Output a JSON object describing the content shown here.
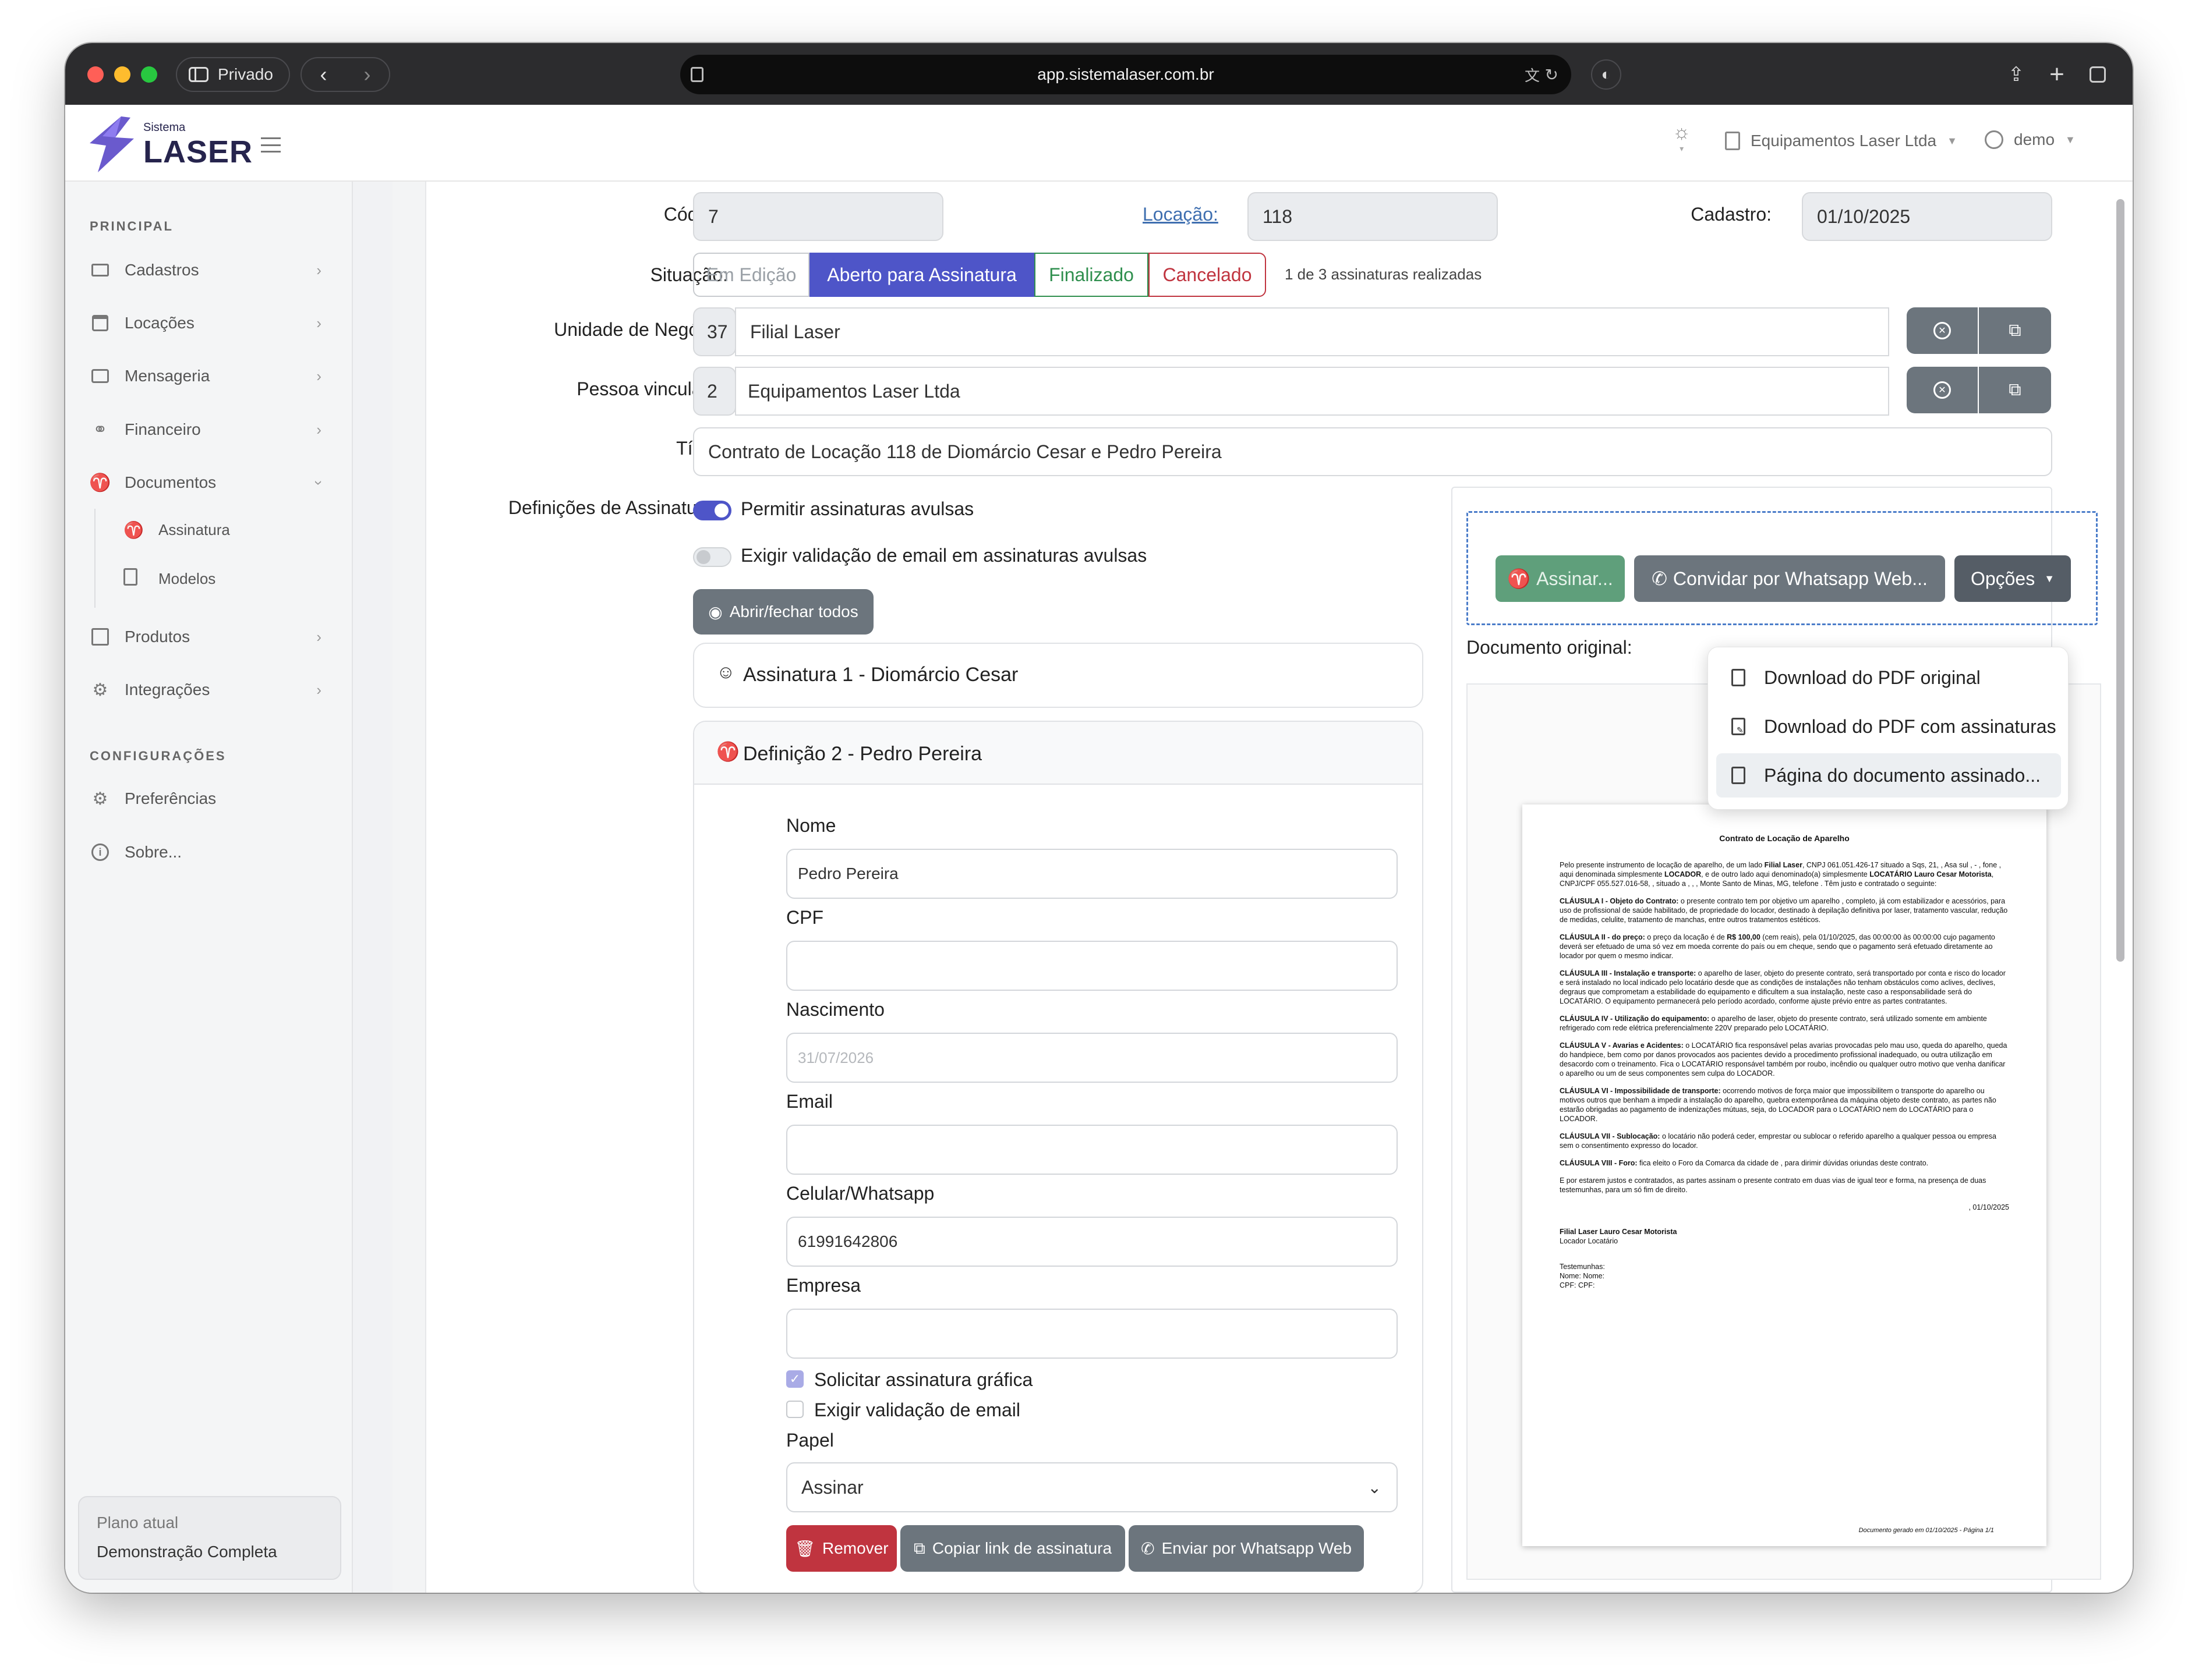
{
  "browser": {
    "private_label": "Privado",
    "url": "app.sistemalaser.com.br"
  },
  "header": {
    "logo_small": "Sistema",
    "logo_main": "LASER",
    "company": "Equipamentos Laser Ltda",
    "user": "demo"
  },
  "sidebar": {
    "section_principal": "PRINCIPAL",
    "items": [
      {
        "label": "Cadastros"
      },
      {
        "label": "Locações"
      },
      {
        "label": "Mensageria"
      },
      {
        "label": "Financeiro"
      },
      {
        "label": "Documentos"
      }
    ],
    "sub_items": [
      {
        "label": "Assinatura"
      },
      {
        "label": "Modelos"
      }
    ],
    "items2": [
      {
        "label": "Produtos"
      },
      {
        "label": "Integrações"
      }
    ],
    "section_config": "CONFIGURAÇÕES",
    "config_items": [
      {
        "label": "Preferências"
      },
      {
        "label": "Sobre..."
      }
    ],
    "plan_label": "Plano atual",
    "plan_value": "Demonstração Completa"
  },
  "form": {
    "codigo_label": "Código:",
    "codigo_value": "7",
    "locacao_label": "Locação:",
    "locacao_value": "118",
    "cadastro_label": "Cadastro:",
    "cadastro_value": "01/10/2025",
    "situacao_label": "Situação:",
    "situacao_options": [
      "Em Edição",
      "Aberto para Assinatura",
      "Finalizado",
      "Cancelado"
    ],
    "assinaturas_count": "1 de 3 assinaturas realizadas",
    "unidade_label": "Unidade de Negócio:",
    "unidade_id": "37",
    "unidade_name": "Filial Laser",
    "pessoa_label": "Pessoa vinculada:",
    "pessoa_id": "2",
    "pessoa_name": "Equipamentos Laser Ltda",
    "titulo_label": "Título:",
    "titulo_value": "Contrato de Locação 118 de Diomárcio Cesar e Pedro Pereira",
    "definicoes_label": "Definições de Assinaturas:",
    "toggle_avulsas": "Permitir assinaturas avulsas",
    "toggle_email": "Exigir validação de email em assinaturas avulsas",
    "abrir_fechar": "Abrir/fechar todos"
  },
  "signatures": {
    "sig1_title": "Assinatura 1 - Diomárcio Cesar",
    "def2_title": "Definição 2 - Pedro Pereira",
    "nome_label": "Nome",
    "nome_value": "Pedro Pereira",
    "cpf_label": "CPF",
    "cpf_value": "",
    "nasc_label": "Nascimento",
    "nasc_placeholder": "31/07/2026",
    "email_label": "Email",
    "email_value": "",
    "cel_label": "Celular/Whatsapp",
    "cel_value": "61991642806",
    "empresa_label": "Empresa",
    "empresa_value": "",
    "cb_grafica": "Solicitar assinatura gráfica",
    "cb_email": "Exigir validação de email",
    "papel_label": "Papel",
    "papel_value": "Assinar",
    "btn_remover": "Remover",
    "btn_copiar": "Copiar link de assinatura",
    "btn_whatsapp": "Enviar por Whatsapp Web"
  },
  "actions": {
    "assinar": "Assinar...",
    "convidar": "Convidar por Whatsapp Web...",
    "opcoes": "Opções",
    "doc_original_label": "Documento original:",
    "menu": [
      "Download do PDF original",
      "Download do PDF com assinaturas",
      "Página do documento assinado..."
    ]
  },
  "document": {
    "title": "Contrato de Locação de Aparelho",
    "intro_a": "Pelo presente instrumento de locação de aparelho, de um lado ",
    "intro_b": "Filial Laser",
    "intro_c": ", CNPJ 061.051.426-17 situado a Sqs, 21, , Asa sul , - , fone , aqui denominada simplesmente ",
    "intro_d": "LOCADOR",
    "intro_e": ", e de outro lado aqui denominado(a) simplesmente ",
    "intro_f": "LOCATÁRIO Lauro Cesar Motorista",
    "intro_g": ", CNPJ/CPF 055.527.016-58, , situado a , , , Monte Santo de Minas, MG, telefone . Têm justo e contratado o seguinte:",
    "c1_h": "CLÁUSULA I - Objeto do Contrato:",
    "c1_t": " o presente contrato tem por objetivo um aparelho , completo, já com estabilizador e acessórios, para uso de profissional de saúde habilitado, de propriedade do locador, destinado à depilação definitiva por laser, tratamento vascular, redução de medidas, celulite, tratamento de manchas, entre outros tratamentos estéticos.",
    "c2_h": "CLÁUSULA II - do preço:",
    "c2_a": " o preço da locação é de ",
    "c2_b": "R$ 100,00",
    "c2_c": " (cem reais), pela 01/10/2025, das 00:00:00 às 00:00:00 cujo pagamento deverá ser efetuado de uma só vez em moeda corrente do país ou em cheque, sendo que o pagamento será efetuado diretamente ao locador por quem o mesmo indicar.",
    "c3_h": "CLÁUSULA III - Instalação e transporte:",
    "c3_t": " o aparelho de laser, objeto do presente contrato, será transportado por conta e risco do locador e será instalado no local indicado pelo locatário desde que as condições de instalações não tenham obstáculos como aclives, declives, degraus que comprometam a estabilidade do equipamento e dificultem a sua instalação, neste caso a responsabilidade será do LOCATÁRIO. O equipamento permanecerá pelo período acordado, conforme ajuste prévio entre as partes contratantes.",
    "c4_h": "CLÁUSULA IV - Utilização do equipamento:",
    "c4_t": " o aparelho de laser, objeto do presente contrato, será utilizado somente em ambiente refrigerado com rede elétrica preferencialmente 220V preparado pelo LOCATÁRIO.",
    "c5_h": "CLÁUSULA V - Avarias e Acidentes:",
    "c5_t": " o LOCATÁRIO fica responsável pelas avarias provocadas pelo mau uso, queda do aparelho, queda do handpiece, bem como por danos provocados aos pacientes devido a procedimento profissional inadequado, ou outra utilização em desacordo com o treinamento. Fica o LOCATÁRIO responsável também por roubo, incêndio ou qualquer outro motivo que venha danificar o aparelho ou um de seus componentes sem culpa do LOCADOR.",
    "c6_h": "CLÁUSULA VI - Impossibilidade de transporte:",
    "c6_t": " ocorrendo motivos de força maior que impossibilitem o transporte do aparelho ou motivos outros que benham a impedir a instalação do aparelho, quebra extemporânea da máquina objeto deste contrato, as partes não estarão obrigadas ao pagamento de indenizações mútuas, seja, do LOCADOR para o LOCATÁRIO nem do LOCATÁRIO para o LOCADOR.",
    "c7_h": "CLÁUSULA VII - Sublocação:",
    "c7_t": " o locatário não poderá ceder, emprestar ou sublocar o referido aparelho a qualquer pessoa ou empresa sem o consentimento expresso do locador.",
    "c8_h": "CLÁUSULA VIII - Foro:",
    "c8_t": " fica eleito o Foro da Comarca da cidade de , para dirimir dúvidas oriundas deste contrato.",
    "closing": "E por estarem justos e contratados, as partes assinam o presente contrato em duas vias de igual teor e forma, na presença de duas testemunhas, para um só fim de direito.",
    "date": ", 01/10/2025",
    "sign_names": "Filial Laser Lauro Cesar Motorista",
    "sign_roles": "Locador Locatário",
    "witness1": "Testemunhas:",
    "witness2": "Nome: Nome:",
    "witness3": "CPF: CPF:",
    "footer": "Documento gerado em 01/10/2025 - Página 1/1"
  },
  "colors": {
    "primary": "#4e55c8",
    "success": "#2f8f4e",
    "danger": "#c0343f",
    "secondary": "#6c757d",
    "green_btn": "#5f9f7b"
  }
}
